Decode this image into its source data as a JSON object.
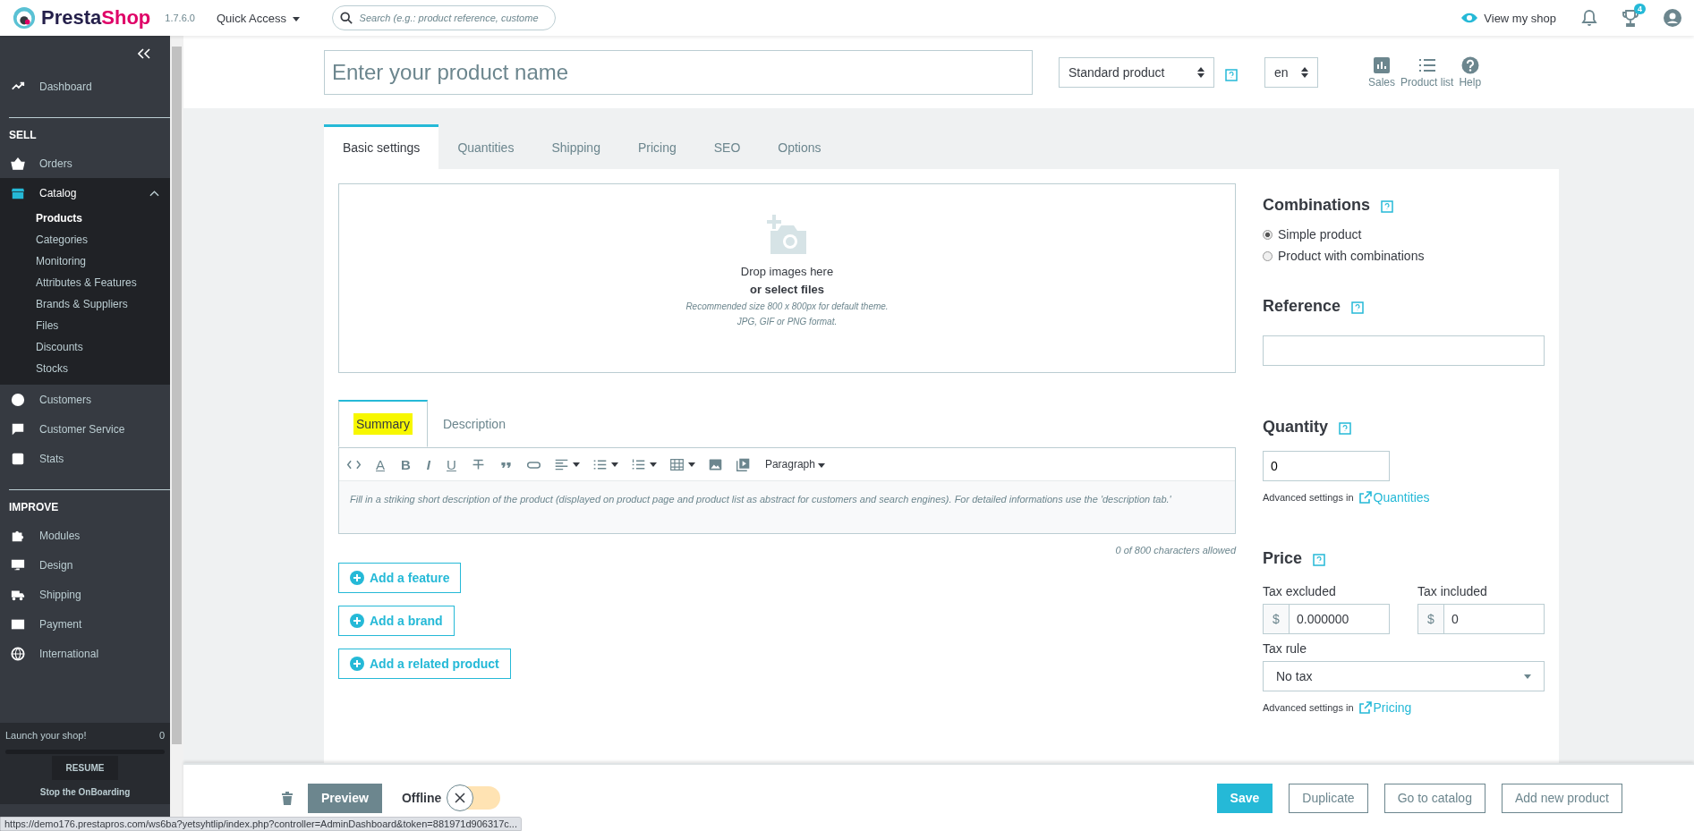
{
  "header": {
    "logo": {
      "first": "Presta",
      "second": "Shop"
    },
    "version": "1.7.6.0",
    "quick_access": "Quick Access",
    "search": {
      "placeholder": "Search (e.g.: product reference, custome"
    },
    "view_shop": "View my shop",
    "notifications_badge": "4"
  },
  "sidebar": {
    "items": [
      {
        "kind": "item",
        "label": "Dashboard",
        "selected": false
      },
      {
        "kind": "section",
        "label": "SELL"
      },
      {
        "kind": "item",
        "label": "Orders",
        "selected": false
      },
      {
        "kind": "item",
        "label": "Catalog",
        "selected": true,
        "expanded": true,
        "children": [
          {
            "label": "Products",
            "selected": true
          },
          {
            "label": "Categories",
            "selected": false
          },
          {
            "label": "Monitoring",
            "selected": false
          },
          {
            "label": "Attributes & Features",
            "selected": false
          },
          {
            "label": "Brands & Suppliers",
            "selected": false
          },
          {
            "label": "Files",
            "selected": false
          },
          {
            "label": "Discounts",
            "selected": false
          },
          {
            "label": "Stocks",
            "selected": false
          }
        ]
      },
      {
        "kind": "item",
        "label": "Customers",
        "selected": false
      },
      {
        "kind": "item",
        "label": "Customer Service",
        "selected": false
      },
      {
        "kind": "item",
        "label": "Stats",
        "selected": false
      },
      {
        "kind": "section",
        "label": "IMPROVE"
      },
      {
        "kind": "item",
        "label": "Modules",
        "selected": false
      },
      {
        "kind": "item",
        "label": "Design",
        "selected": false
      },
      {
        "kind": "item",
        "label": "Shipping",
        "selected": false
      },
      {
        "kind": "item",
        "label": "Payment",
        "selected": false
      },
      {
        "kind": "item",
        "label": "International",
        "selected": false
      }
    ],
    "onboarding": {
      "title": "Launch your shop!",
      "percent": "0",
      "level": 0,
      "resume": "RESUME",
      "stop": "Stop the OnBoarding"
    }
  },
  "product_header": {
    "name": {
      "placeholder": "Enter your product name"
    },
    "type": "Standard product",
    "language": "en",
    "actions": [
      {
        "label": "Sales"
      },
      {
        "label": "Product list"
      },
      {
        "label": "Help"
      }
    ]
  },
  "tabs": [
    {
      "label": "Basic settings",
      "selected": true
    },
    {
      "label": "Quantities",
      "selected": false
    },
    {
      "label": "Shipping",
      "selected": false
    },
    {
      "label": "Pricing",
      "selected": false
    },
    {
      "label": "SEO",
      "selected": false
    },
    {
      "label": "Options",
      "selected": false
    }
  ],
  "dropzone": {
    "title": "Drop images here",
    "link": "or select files",
    "hint_1": "Recommended size 800 x 800px for default theme.",
    "hint_2": "JPG, GIF or PNG format."
  },
  "editor": {
    "tabs": [
      {
        "label": "Summary",
        "selected": true,
        "highlighted": true
      },
      {
        "label": "Description",
        "selected": false,
        "highlighted": false
      }
    ],
    "toolbar": [
      {
        "kind": "code"
      },
      {
        "kind": "color",
        "text": "A"
      },
      {
        "kind": "bold",
        "text": "B"
      },
      {
        "kind": "italic",
        "text": "I"
      },
      {
        "kind": "underline",
        "text": "U"
      },
      {
        "kind": "strike"
      },
      {
        "kind": "quote"
      },
      {
        "kind": "link"
      },
      {
        "kind": "align"
      },
      {
        "kind": "bullets"
      },
      {
        "kind": "numbers"
      },
      {
        "kind": "table"
      },
      {
        "kind": "image"
      },
      {
        "kind": "media"
      },
      {
        "kind": "format",
        "text": "Paragraph"
      }
    ],
    "placeholder": "Fill in a striking short description of the product (displayed on product page and product list as abstract for customers and search engines). For detailed informations use the 'description tab.'",
    "counter": "0 of 800 characters allowed"
  },
  "add_buttons": [
    "Add a feature",
    "Add a brand",
    "Add a related product"
  ],
  "combinations": {
    "title": "Combinations",
    "options": [
      {
        "label": "Simple product",
        "selected": true
      },
      {
        "label": "Product with combinations",
        "selected": false
      }
    ]
  },
  "reference": {
    "title": "Reference"
  },
  "quantity": {
    "title": "Quantity",
    "value": "0",
    "advanced": "Advanced settings in",
    "link": "Quantities"
  },
  "price": {
    "title": "Price",
    "tax_excluded": {
      "label": "Tax excluded",
      "currency": "$",
      "value": "0.000000"
    },
    "tax_included": {
      "label": "Tax included",
      "currency": "$",
      "value": "0"
    },
    "tax_rule": {
      "label": "Tax rule",
      "value": "No tax"
    },
    "advanced": "Advanced settings in",
    "link": "Pricing"
  },
  "footer": {
    "preview": "Preview",
    "status_label": "Offline",
    "online": false,
    "buttons": [
      {
        "label": "Save",
        "primary": true
      },
      {
        "label": "Duplicate",
        "primary": false
      },
      {
        "label": "Go to catalog",
        "primary": false
      },
      {
        "label": "Add new product",
        "primary": false
      }
    ]
  },
  "browser_status": "https://demo176.prestapros.com/ws6ba?yetsyhtlip/index.php?controller=AdminDashboard&token=881971d906317c..."
}
